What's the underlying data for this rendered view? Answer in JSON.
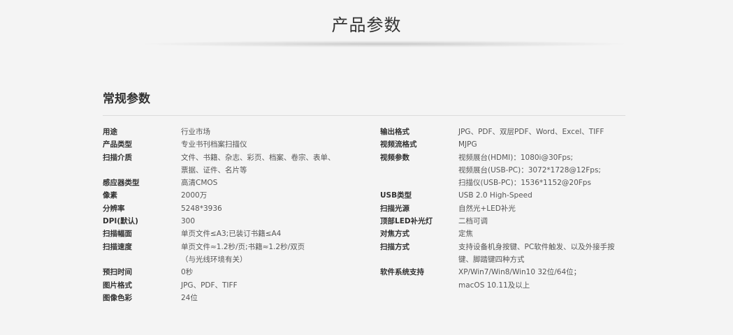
{
  "page": {
    "title": "产品参数",
    "section_title": "常规参数"
  },
  "left_params": [
    {
      "label": "用途",
      "lines": [
        "行业市场"
      ]
    },
    {
      "label": "产品类型",
      "lines": [
        "专业书刊档案扫描仪"
      ]
    },
    {
      "label": "扫描介质",
      "lines": [
        "文件、书籍、杂志、彩页、档案、卷宗、表单、",
        "票据、证件、名片等"
      ]
    },
    {
      "label": "感应器类型",
      "lines": [
        "高清CMOS"
      ]
    },
    {
      "label": "像素",
      "lines": [
        "2000万"
      ]
    },
    {
      "label": "分辨率",
      "lines": [
        "5248*3936"
      ]
    },
    {
      "label": "DPI(默认)",
      "lines": [
        "300"
      ]
    },
    {
      "label": "扫描幅面",
      "lines": [
        "单页文件≤A3;已装订书籍≤A4"
      ]
    },
    {
      "label": "扫描速度",
      "lines": [
        "单页文件≈1.2秒/页;书籍≈1.2秒/双页",
        "（与光线环境有关）"
      ]
    },
    {
      "label": "预扫时间",
      "lines": [
        "0秒"
      ]
    },
    {
      "label": "图片格式",
      "lines": [
        "JPG、PDF、TIFF"
      ]
    },
    {
      "label": "图像色彩",
      "lines": [
        "24位"
      ]
    }
  ],
  "right_params": [
    {
      "label": "输出格式",
      "lines": [
        "JPG、PDF、双层PDF、Word、Excel、TIFF"
      ]
    },
    {
      "label": "视频流格式",
      "lines": [
        "MJPG"
      ]
    },
    {
      "label": "视频参数",
      "lines": [
        "视频展台(HDMI)：1080i@30Fps;",
        "视频展台(USB-PC)：3072*1728@12Fps;",
        "扫描仪(USB-PC)：1536*1152@20Fps"
      ]
    },
    {
      "label": "USB类型",
      "lines": [
        "USB 2.0 High-Speed"
      ]
    },
    {
      "label": "扫描光源",
      "lines": [
        "自然光+LED补光"
      ]
    },
    {
      "label": "顶部LED补光灯",
      "lines": [
        "二档可调"
      ]
    },
    {
      "label": "对焦方式",
      "lines": [
        "定焦"
      ]
    },
    {
      "label": "扫描方式",
      "lines": [
        "支持设备机身按键、PC软件触发、以及外接手按",
        "键、脚踏键四种方式"
      ]
    },
    {
      "label": "软件系统支持",
      "lines": [
        "XP/Win7/Win8/Win10 32位/64位；",
        "macOS 10.11及以上"
      ]
    }
  ]
}
